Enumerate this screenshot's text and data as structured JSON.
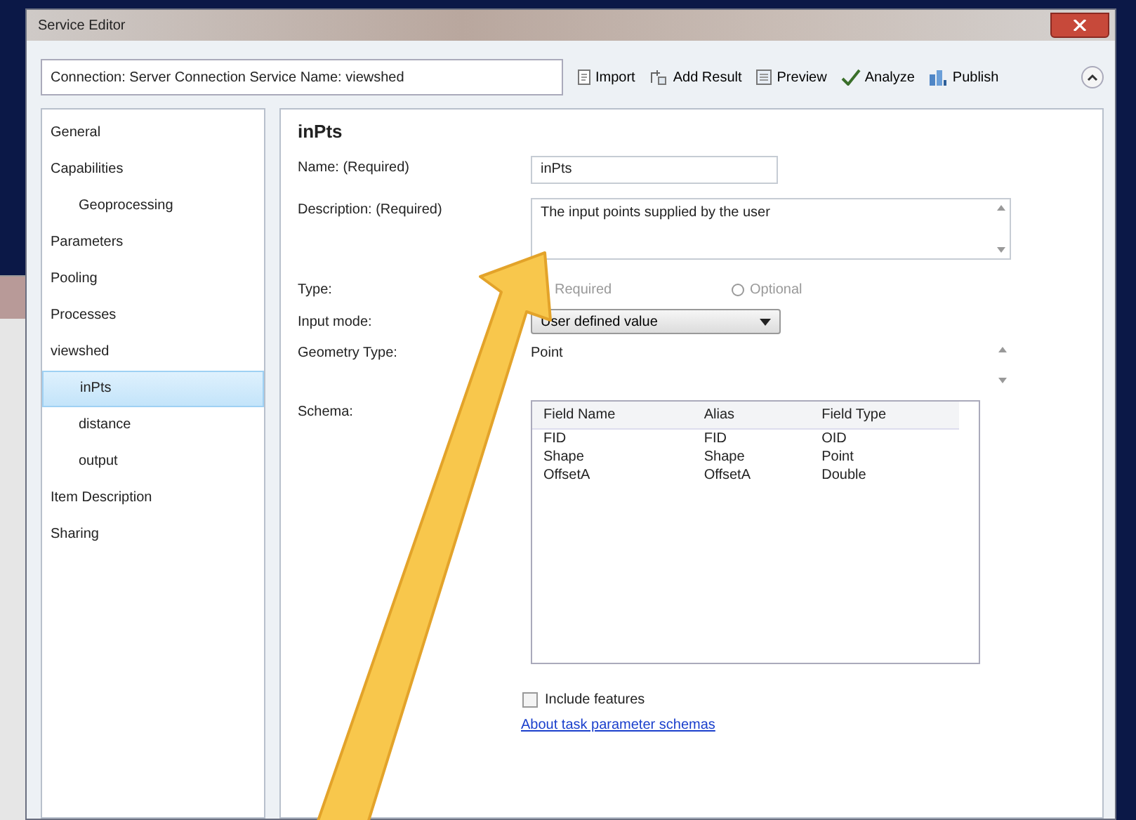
{
  "window": {
    "title": "Service Editor"
  },
  "connection": {
    "text": "Connection: Server Connection   Service Name: viewshed"
  },
  "toolbar": [
    {
      "kind": "import",
      "label": "Import"
    },
    {
      "kind": "add",
      "label": "Add Result"
    },
    {
      "kind": "preview",
      "label": "Preview"
    },
    {
      "kind": "analyze",
      "label": "Analyze"
    },
    {
      "kind": "publish",
      "label": "Publish"
    }
  ],
  "sidebar": {
    "items": [
      {
        "label": "General",
        "selected": false
      },
      {
        "label": "Capabilities",
        "selected": false,
        "children": [
          {
            "label": "Geoprocessing",
            "selected": false
          }
        ]
      },
      {
        "label": "Parameters",
        "selected": false
      },
      {
        "label": "Pooling",
        "selected": false
      },
      {
        "label": "Processes",
        "selected": false
      },
      {
        "label": "viewshed",
        "selected": false,
        "children": [
          {
            "label": "inPts",
            "selected": true
          },
          {
            "label": "distance",
            "selected": false
          },
          {
            "label": "output",
            "selected": false
          }
        ]
      },
      {
        "label": "Item Description",
        "selected": false
      },
      {
        "label": "Sharing",
        "selected": false
      }
    ]
  },
  "form": {
    "title": "inPts",
    "name": {
      "label": "Name: (Required)",
      "value": "inPts"
    },
    "description": {
      "label": "Description: (Required)",
      "value": "The input points supplied by the user"
    },
    "type": {
      "label": "Type:",
      "options": [
        {
          "kind": "label",
          "label": "Required"
        },
        {
          "kind": "radio",
          "label": "Optional",
          "selected": false
        }
      ]
    },
    "input_mode": {
      "label": "Input mode:",
      "value": "User defined value"
    },
    "geometry_type": {
      "label": "Geometry Type:",
      "value": "Point"
    },
    "schema": {
      "label": "Schema:",
      "columns": [
        "Field Name",
        "Alias",
        "Field Type"
      ],
      "rows": [
        [
          "FID",
          "FID",
          "OID"
        ],
        [
          "Shape",
          "Shape",
          "Point"
        ],
        [
          "OffsetA",
          "OffsetA",
          "Double"
        ]
      ]
    },
    "include_features": {
      "label": "Include features",
      "checked": false
    },
    "link": "About task parameter schemas"
  }
}
